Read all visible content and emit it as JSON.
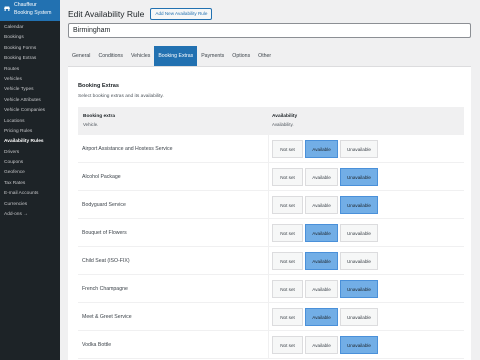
{
  "app": {
    "name_line1": "Chauffeur",
    "name_line2": "Booking System"
  },
  "sidebar": {
    "items": [
      {
        "label": "Calendar"
      },
      {
        "label": "Bookings"
      },
      {
        "label": "Booking Forms"
      },
      {
        "label": "Booking Extras"
      },
      {
        "label": "Routes"
      },
      {
        "label": "Vehicles"
      },
      {
        "label": "Vehicle Types"
      },
      {
        "label": "Vehicle Attributes"
      },
      {
        "label": "Vehicle Companies"
      },
      {
        "label": "Locations"
      },
      {
        "label": "Pricing Rules"
      },
      {
        "label": "Availability Rules",
        "active": true
      },
      {
        "label": "Drivers"
      },
      {
        "label": "Coupons"
      },
      {
        "label": "Geofence"
      },
      {
        "label": "Tax Rates"
      },
      {
        "label": "E-mail Accounts"
      },
      {
        "label": "Currencies"
      },
      {
        "label": "Add-ons →"
      }
    ]
  },
  "header": {
    "title": "Edit Availability Rule",
    "add_new_label": "Add New Availability Rule"
  },
  "rule": {
    "title_value": "Birmingham"
  },
  "tabs": [
    {
      "label": "General"
    },
    {
      "label": "Conditions"
    },
    {
      "label": "Vehicles"
    },
    {
      "label": "Booking Extras",
      "active": true
    },
    {
      "label": "Payments"
    },
    {
      "label": "Options"
    },
    {
      "label": "Other"
    }
  ],
  "section": {
    "title": "Booking Extras",
    "description": "Select booking extras and its availability."
  },
  "table": {
    "col1_title": "Booking extra",
    "col1_sub": "Vehicle.",
    "col2_title": "Availability",
    "col2_sub": "Availability.",
    "option_labels": [
      "Not set",
      "Available",
      "Unavailable"
    ],
    "rows": [
      {
        "name": "Airport Assistance and Hostess Service",
        "selected": "Available"
      },
      {
        "name": "Alcohol Package",
        "selected": "Unavailable"
      },
      {
        "name": "Bodyguard Service",
        "selected": "Unavailable"
      },
      {
        "name": "Bouquet of Flowers",
        "selected": "Available"
      },
      {
        "name": "Child Seat (ISO-FIX)",
        "selected": "Available"
      },
      {
        "name": "French Champagne",
        "selected": "Unavailable"
      },
      {
        "name": "Meet & Greet Service",
        "selected": "Available"
      },
      {
        "name": "Vodka Bottle",
        "selected": "Unavailable"
      }
    ]
  },
  "colors": {
    "sidebar_bg": "#1d2327",
    "accent": "#2271b1",
    "selected_option": "#72aee6"
  },
  "icons": {
    "app_menu": "car-icon"
  }
}
